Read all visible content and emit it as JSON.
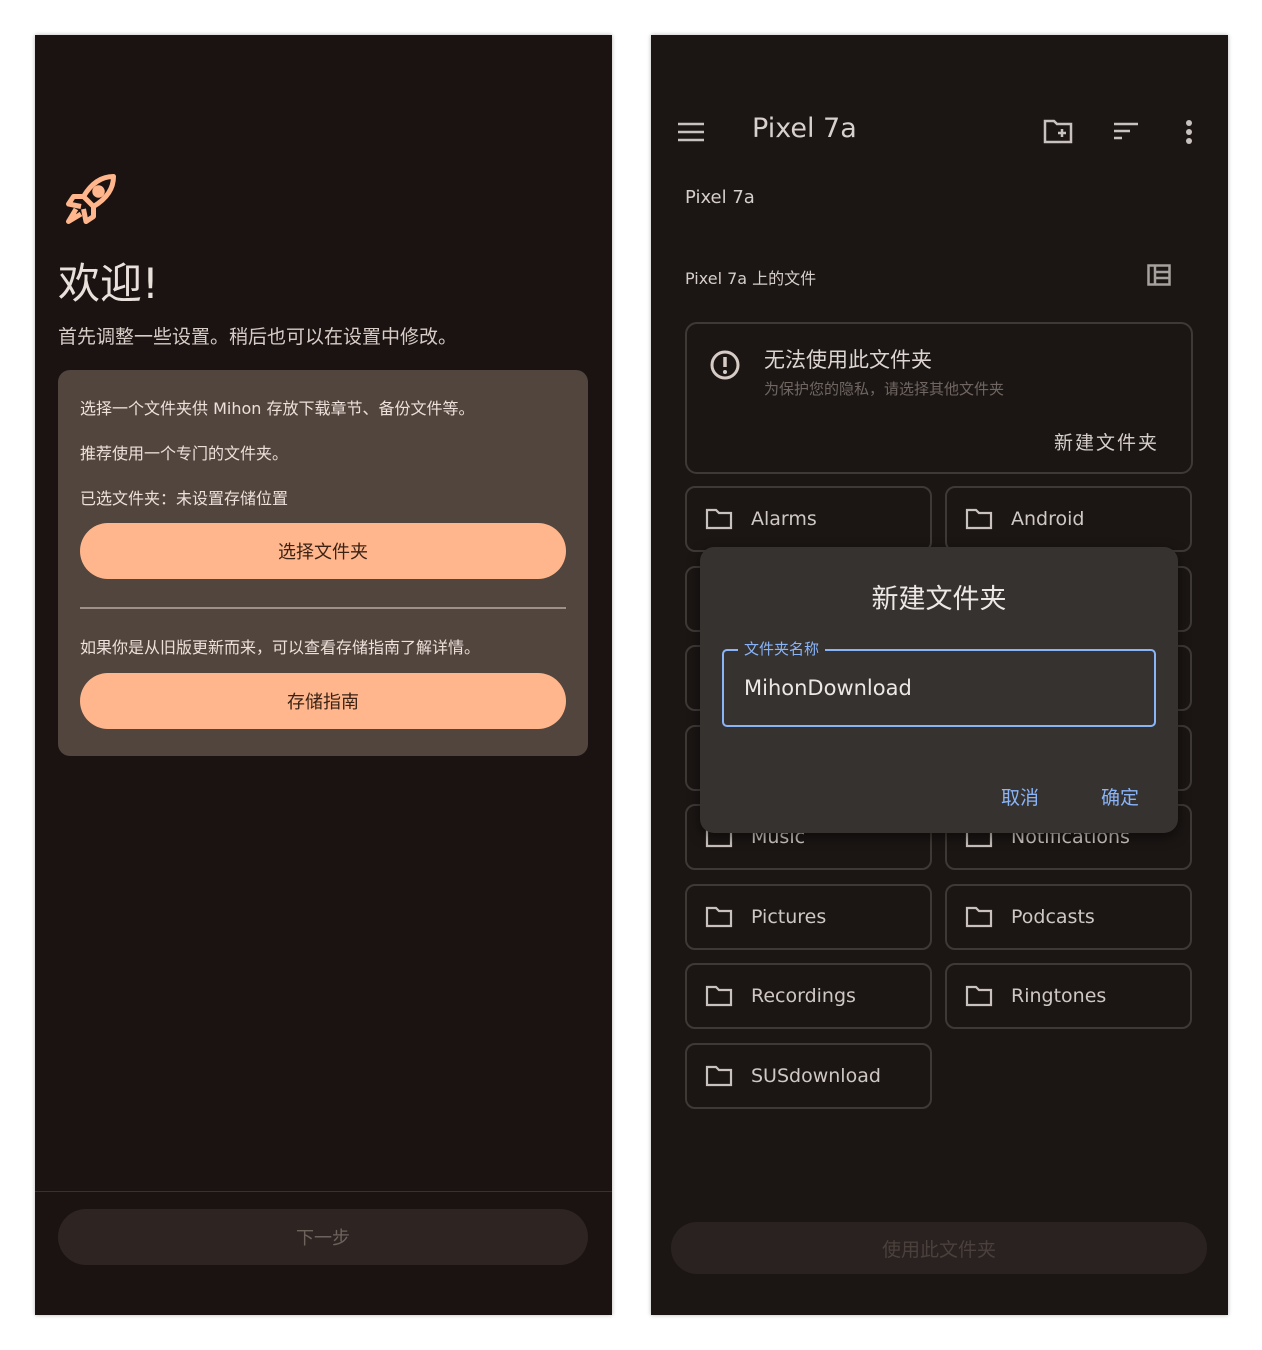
{
  "left": {
    "title": "欢迎!",
    "subtitle": "首先调整一些设置。稍后也可以在设置中修改。",
    "card": {
      "line1": "选择一个文件夹供 Mihon 存放下载章节、备份文件等。",
      "line2": "推荐使用一个专门的文件夹。",
      "line3": "已选文件夹：未设置存储位置",
      "select_button": "选择文件夹",
      "line4": "如果你是从旧版更新而来，可以查看存储指南了解详情。",
      "guide_button": "存储指南"
    },
    "next_button": "下一步",
    "accent": "#ffb68c"
  },
  "right": {
    "toolbar": {
      "title": "Pixel 7a"
    },
    "breadcrumb": "Pixel 7a",
    "section_title": "Pixel 7a 上的文件",
    "warning": {
      "title": "无法使用此文件夹",
      "subtitle": "为保护您的隐私，请选择其他文件夹",
      "action": "新建文件夹"
    },
    "folders": [
      "Alarms",
      "Android",
      "",
      "",
      "",
      "",
      "",
      "",
      "Music",
      "Notifications",
      "Pictures",
      "Podcasts",
      "Recordings",
      "Ringtones",
      "SUSdownload"
    ],
    "dialog": {
      "title": "新建文件夹",
      "field_label": "文件夹名称",
      "field_value": "MihonDownload",
      "cancel": "取消",
      "confirm": "确定",
      "accent": "#8ab4f8"
    },
    "use_button": "使用此文件夹"
  }
}
